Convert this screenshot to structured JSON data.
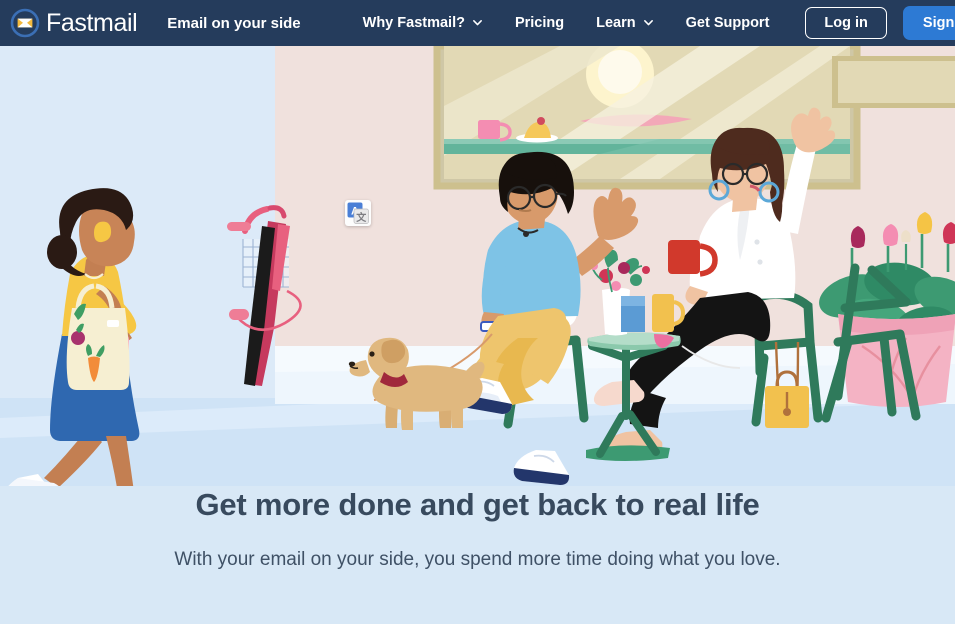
{
  "nav": {
    "logo_icon": "fastmail-envelope-logo-icon",
    "brand": "Fastmail",
    "tagline": "Email on your side",
    "links": [
      {
        "label": "Why Fastmail?",
        "has_chevron": true,
        "icon": "chevron-down-icon"
      },
      {
        "label": "Pricing",
        "has_chevron": false
      },
      {
        "label": "Learn",
        "has_chevron": true,
        "icon": "chevron-down-icon"
      },
      {
        "label": "Get Support",
        "has_chevron": false
      }
    ],
    "login_label": "Log in",
    "signup_label": "Sign up",
    "bg_color": "#253c5c",
    "signup_color": "#2d7ad4"
  },
  "hero": {
    "illustration_alt": "People relaxing at a cafe with a window, plants, a dog and a woman walking by",
    "translate_icon": "google-translate-icon",
    "headline": "Get more done and get back to real life",
    "subheadline": "With your email on your side, you spend more time doing what you love.",
    "background_color": "#d8e8f6",
    "wall_color": "#f0e1dd",
    "floor_color": "#cfe3f6",
    "headline_color": "#384a5e"
  }
}
